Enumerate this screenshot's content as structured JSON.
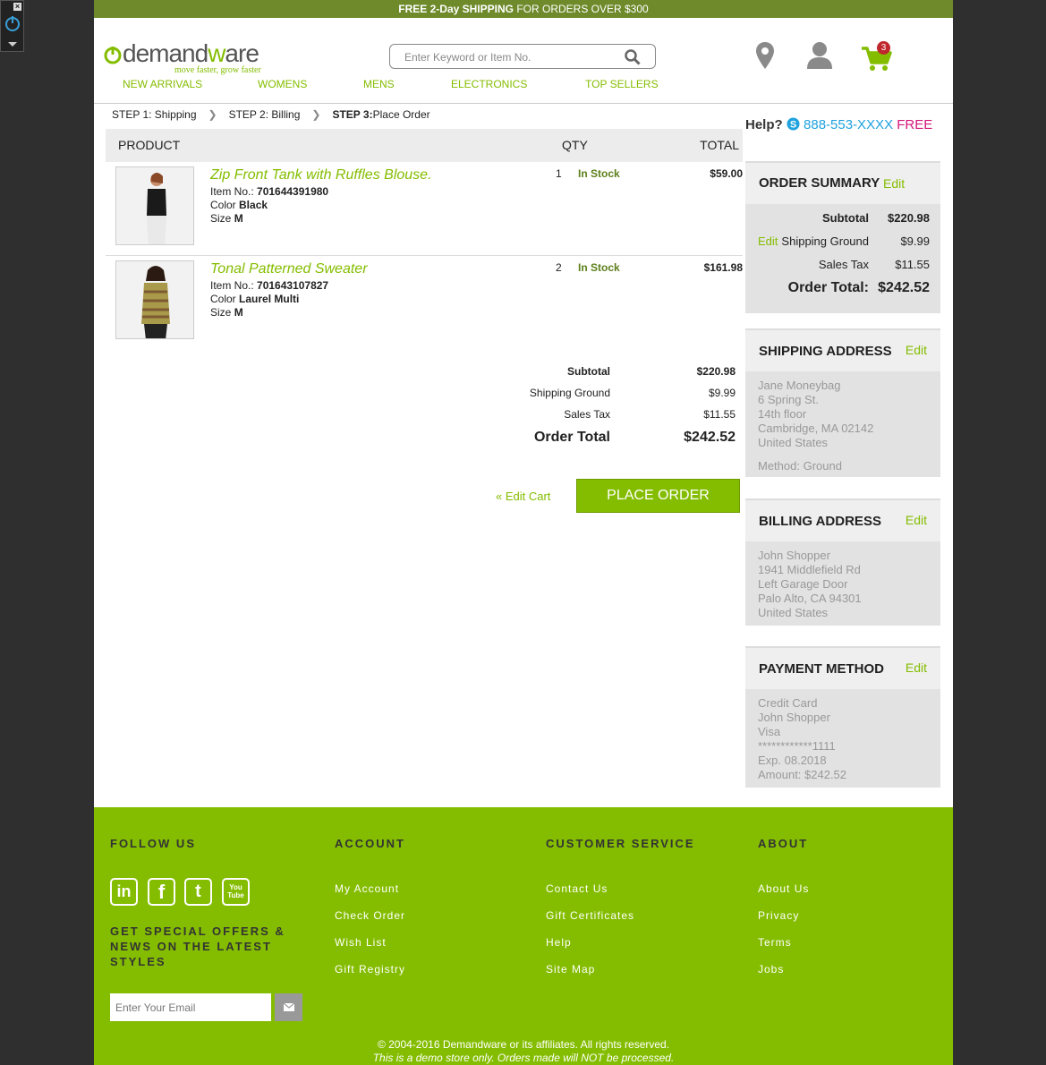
{
  "promo": {
    "bold": "FREE 2-Day SHIPPING",
    "rest": " FOR ORDERS OVER $300"
  },
  "logo": {
    "word_pre": "demand",
    "word_green": "w",
    "word_post": "are",
    "tagline": "move faster, grow faster"
  },
  "search": {
    "placeholder": "Enter Keyword or Item No."
  },
  "cart": {
    "count": "3"
  },
  "icons": {
    "location": "map-pin-icon",
    "account": "user-icon",
    "cart": "cart-icon",
    "search": "search-icon"
  },
  "nav": [
    "NEW ARRIVALS",
    "WOMENS",
    "MENS",
    "ELECTRONICS",
    "TOP SELLERS"
  ],
  "steps": {
    "s1": "STEP 1: Shipping",
    "s2": "STEP 2: Billing",
    "s3_bold": "STEP 3:",
    "s3_rest": " Place Order"
  },
  "table_headers": {
    "product": "PRODUCT",
    "qty": "QTY",
    "total": "TOTAL"
  },
  "items": [
    {
      "name": "Zip Front Tank with Ruffles Blouse.",
      "item_label": "Item No.: ",
      "item_no": "701644391980",
      "color_label": "Color ",
      "color": "Black",
      "size_label": "Size ",
      "size": "M",
      "qty": "1",
      "stock": "In Stock",
      "price": "$59.00"
    },
    {
      "name": "Tonal Patterned Sweater",
      "item_label": "Item No.: ",
      "item_no": "701643107827",
      "color_label": "Color ",
      "color": "Laurel Multi",
      "size_label": "Size ",
      "size": "M",
      "qty": "2",
      "stock": "In Stock",
      "price": "$161.98"
    }
  ],
  "totals": {
    "subtotal_label": "Subtotal",
    "subtotal": "$220.98",
    "shipping_label": "Shipping Ground",
    "shipping": "$9.99",
    "tax_label": "Sales Tax",
    "tax": "$11.55",
    "order_label": "Order Total",
    "order": "$242.52"
  },
  "actions": {
    "edit_cart": "« Edit Cart",
    "place_order": "PLACE ORDER"
  },
  "help": {
    "label": "Help?",
    "phone": "888-553-XXXX",
    "free": "FREE"
  },
  "summary": {
    "title": "ORDER SUMMARY",
    "edit": "Edit",
    "subtotal_label": "Subtotal",
    "subtotal": "$220.98",
    "ship_edit": "Edit",
    "shipping_label": "Shipping Ground",
    "shipping": "$9.99",
    "tax_label": "Sales Tax",
    "tax": "$11.55",
    "order_label": "Order Total:",
    "order": "$242.52"
  },
  "shipping_address": {
    "title": "SHIPPING ADDRESS",
    "edit": "Edit",
    "lines": [
      "Jane Moneybag",
      "6 Spring St.",
      "14th floor",
      "Cambridge, MA 02142",
      "United States"
    ],
    "method": "Method: Ground"
  },
  "billing_address": {
    "title": "BILLING ADDRESS",
    "edit": "Edit",
    "lines": [
      "John Shopper",
      "1941 Middlefield Rd",
      "Left Garage Door",
      "Palo Alto, CA 94301",
      "United States"
    ]
  },
  "payment": {
    "title": "PAYMENT METHOD",
    "edit": "Edit",
    "lines": [
      "Credit Card",
      "John Shopper",
      "Visa",
      "************1111",
      "Exp. 08.2018",
      "Amount: $242.52"
    ]
  },
  "footer": {
    "follow": "FOLLOW US",
    "account": {
      "title": "ACCOUNT",
      "links": [
        "My Account",
        "Check Order",
        "Wish List",
        "Gift Registry"
      ]
    },
    "service": {
      "title": "CUSTOMER SERVICE",
      "links": [
        "Contact Us",
        "Gift Certificates",
        "Help",
        "Site Map"
      ]
    },
    "about": {
      "title": "ABOUT",
      "links": [
        "About Us",
        "Privacy",
        "Terms",
        "Jobs"
      ]
    },
    "social": {
      "linkedin": "in",
      "facebook": "f",
      "twitter": "t",
      "youtube": "You Tube"
    },
    "offers": "GET SPECIAL OFFERS & NEWS ON THE LATEST STYLES",
    "email_placeholder": "Enter Your Email",
    "copyright": "© 2004-2016 Demandware or its affiliates. All rights reserved.",
    "demo": "This is a demo store only. Orders made will NOT be processed."
  },
  "colors": {
    "brand_green": "#84bd00",
    "promo_bar": "#6e8a2a",
    "help_phone": "#1fa2de",
    "free": "#d4157a",
    "badge": "#c0272d"
  }
}
